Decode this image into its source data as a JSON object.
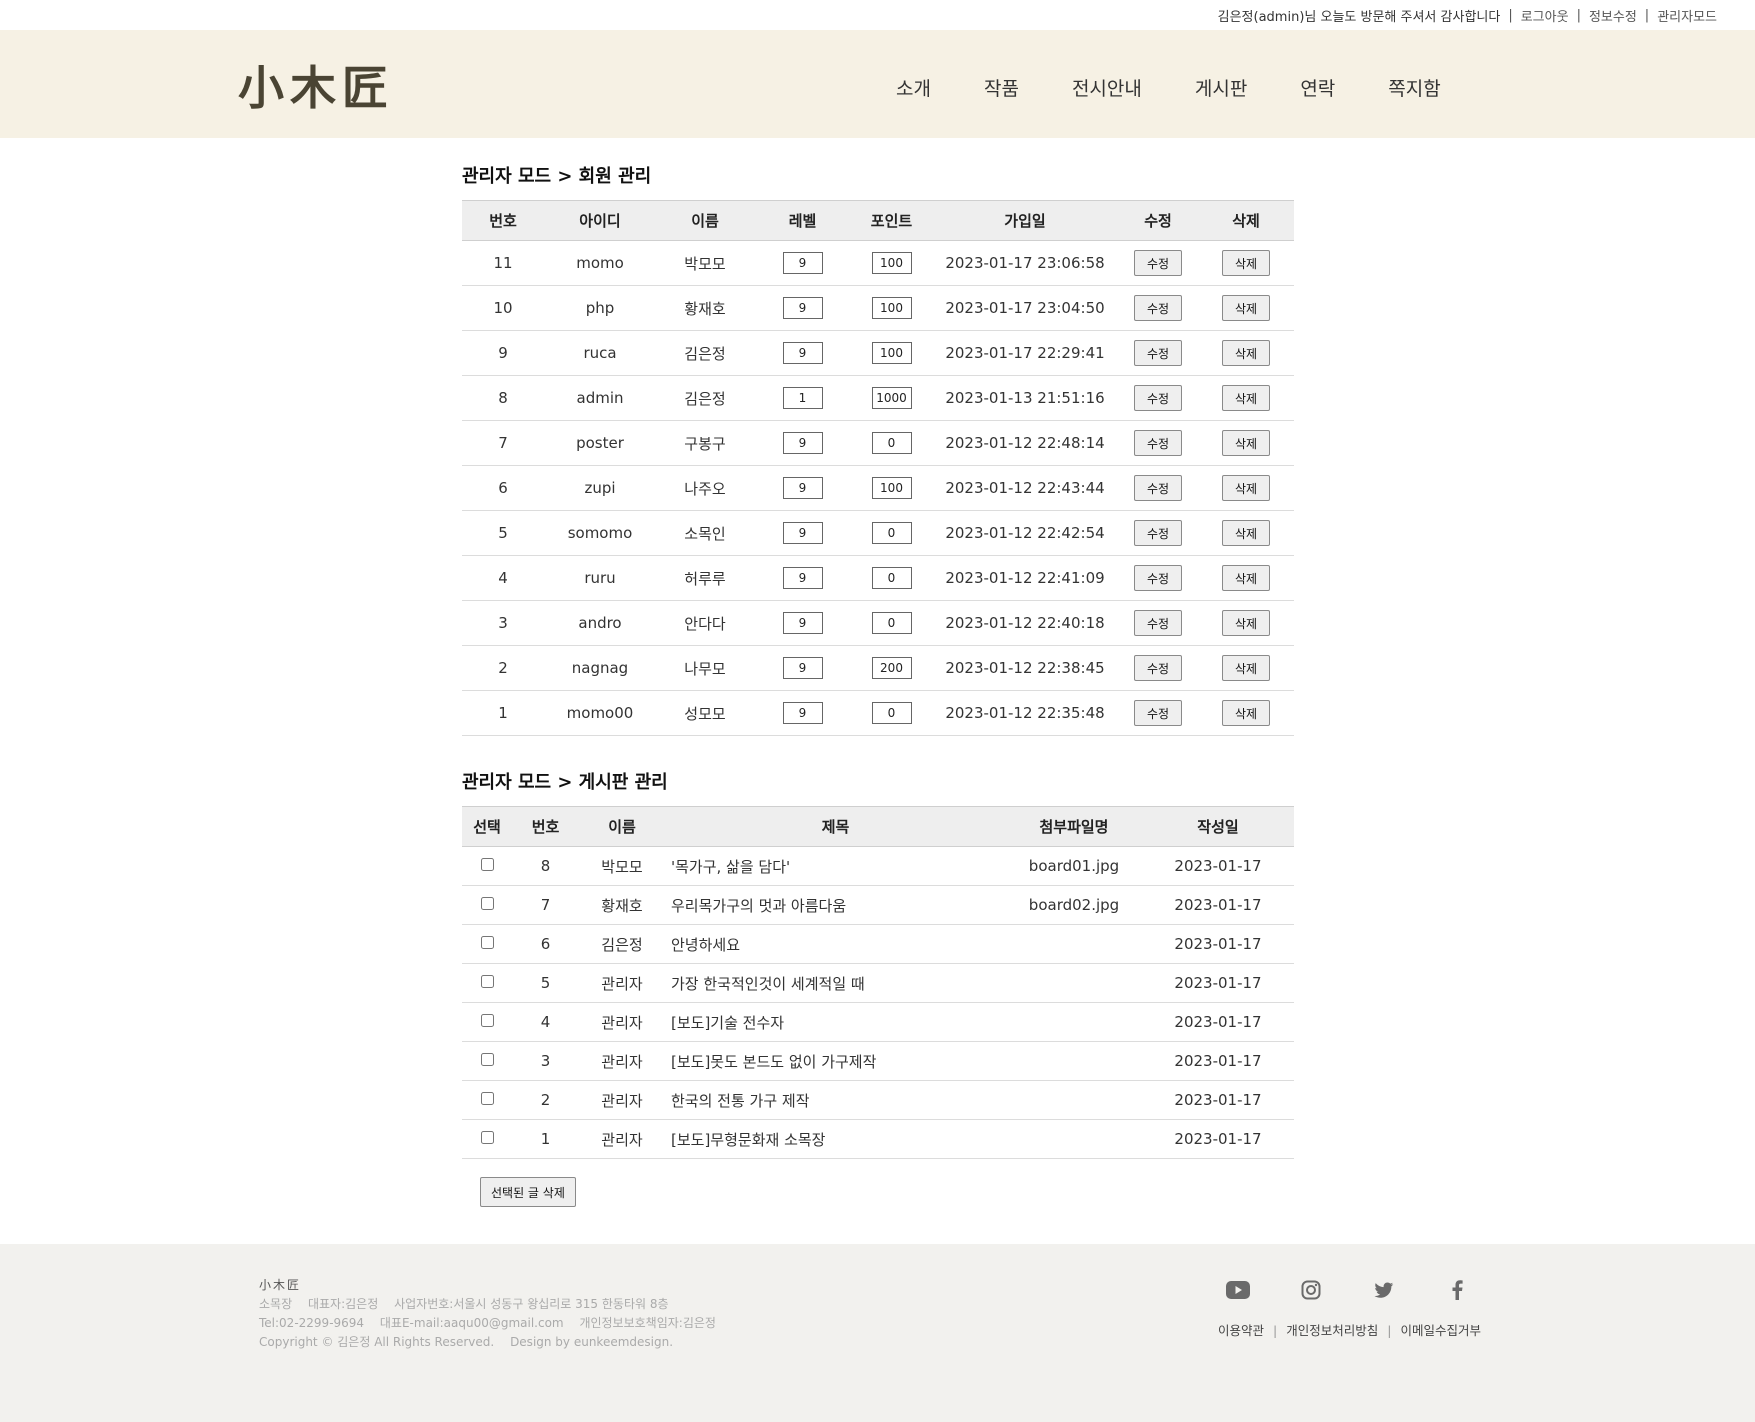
{
  "topbar": {
    "welcome": "김은정(admin)님 오늘도 방문해 주셔서 감사합니다",
    "logout": "로그아웃",
    "edit_info": "정보수정",
    "admin_mode": "관리자모드",
    "separator": "|"
  },
  "header": {
    "logo": "小木匠",
    "nav": [
      "소개",
      "작품",
      "전시안내",
      "게시판",
      "연락",
      "쪽지함"
    ]
  },
  "members": {
    "title": "관리자 모드 > 회원 관리",
    "columns": [
      "번호",
      "아이디",
      "이름",
      "레벨",
      "포인트",
      "가입일",
      "수정",
      "삭제"
    ],
    "edit_label": "수정",
    "delete_label": "삭제",
    "rows": [
      {
        "num": "11",
        "id": "momo",
        "name": "박모모",
        "level": "9",
        "point": "100",
        "joined": "2023-01-17 23:06:58"
      },
      {
        "num": "10",
        "id": "php",
        "name": "황재호",
        "level": "9",
        "point": "100",
        "joined": "2023-01-17 23:04:50"
      },
      {
        "num": "9",
        "id": "ruca",
        "name": "김은정",
        "level": "9",
        "point": "100",
        "joined": "2023-01-17 22:29:41"
      },
      {
        "num": "8",
        "id": "admin",
        "name": "김은정",
        "level": "1",
        "point": "1000",
        "joined": "2023-01-13 21:51:16"
      },
      {
        "num": "7",
        "id": "poster",
        "name": "구봉구",
        "level": "9",
        "point": "0",
        "joined": "2023-01-12 22:48:14"
      },
      {
        "num": "6",
        "id": "zupi",
        "name": "나주오",
        "level": "9",
        "point": "100",
        "joined": "2023-01-12 22:43:44"
      },
      {
        "num": "5",
        "id": "somomo",
        "name": "소목인",
        "level": "9",
        "point": "0",
        "joined": "2023-01-12 22:42:54"
      },
      {
        "num": "4",
        "id": "ruru",
        "name": "허루루",
        "level": "9",
        "point": "0",
        "joined": "2023-01-12 22:41:09"
      },
      {
        "num": "3",
        "id": "andro",
        "name": "안다다",
        "level": "9",
        "point": "0",
        "joined": "2023-01-12 22:40:18"
      },
      {
        "num": "2",
        "id": "nagnag",
        "name": "나무모",
        "level": "9",
        "point": "200",
        "joined": "2023-01-12 22:38:45"
      },
      {
        "num": "1",
        "id": "momo00",
        "name": "성모모",
        "level": "9",
        "point": "0",
        "joined": "2023-01-12 22:35:48"
      }
    ]
  },
  "boards": {
    "title": "관리자 모드 > 게시판 관리",
    "columns": [
      "선택",
      "번호",
      "이름",
      "제목",
      "첨부파일명",
      "작성일"
    ],
    "rows": [
      {
        "num": "8",
        "name": "박모모",
        "subject": "'목가구, 삶을 담다'",
        "file": "board01.jpg",
        "date": "2023-01-17"
      },
      {
        "num": "7",
        "name": "황재호",
        "subject": "우리목가구의 멋과 아름다움",
        "file": "board02.jpg",
        "date": "2023-01-17"
      },
      {
        "num": "6",
        "name": "김은정",
        "subject": "안녕하세요",
        "file": "",
        "date": "2023-01-17"
      },
      {
        "num": "5",
        "name": "관리자",
        "subject": "가장 한국적인것이 세계적일 때",
        "file": "",
        "date": "2023-01-17"
      },
      {
        "num": "4",
        "name": "관리자",
        "subject": "[보도]기술 전수자",
        "file": "",
        "date": "2023-01-17"
      },
      {
        "num": "3",
        "name": "관리자",
        "subject": "[보도]못도 본드도 없이 가구제작",
        "file": "",
        "date": "2023-01-17"
      },
      {
        "num": "2",
        "name": "관리자",
        "subject": "한국의 전통 가구 제작",
        "file": "",
        "date": "2023-01-17"
      },
      {
        "num": "1",
        "name": "관리자",
        "subject": "[보도]무형문화재 소목장",
        "file": "",
        "date": "2023-01-17"
      }
    ],
    "delete_selected": "선택된 글 삭제"
  },
  "footer": {
    "logo": "小木匠",
    "line1": [
      "소목장",
      "대표자:김은정",
      "사업자번호:서울시 성동구 왕십리로 315 한동타워 8층"
    ],
    "line2": [
      "Tel:02-2299-9694",
      "대표E-mail:aaqu00@gmail.com",
      "개인정보보호책임자:김은정"
    ],
    "line3": [
      "Copyright © 김은정  All Rights Reserved.",
      "Design by eunkeemdesign."
    ],
    "icons": [
      "youtube-icon",
      "instagram-icon",
      "twitter-icon",
      "facebook-icon"
    ],
    "links": [
      "이용약관",
      "개인정보처리방침",
      "이메일수집거부"
    ],
    "icon_color": "#6a6a6a"
  },
  "colors": {
    "header_bg": "#f6f1e4",
    "logo": "#4a4433",
    "table_header_bg": "#eeeeee",
    "footer_bg": "#f2f1ee"
  }
}
